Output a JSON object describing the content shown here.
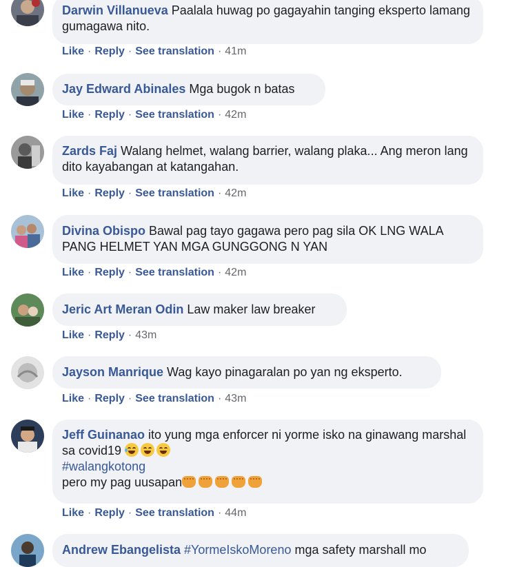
{
  "comments": [
    {
      "author": "Darwin Villanueva",
      "text": "Paalala huwag po gagayahin tanging eksperto lamang gumagawa nito.",
      "actions": {
        "like": "Like",
        "reply": "Reply",
        "translate": "See translation",
        "time": "41m"
      }
    },
    {
      "author": "Jay Edward Abinales",
      "text": "Mga bugok n batas",
      "actions": {
        "like": "Like",
        "reply": "Reply",
        "translate": "See translation",
        "time": "42m"
      }
    },
    {
      "author": "Zards Faj",
      "text": "Walang helmet, walang barrier, walang plaka... Ang meron lang dito kayabangan at katangahan.",
      "actions": {
        "like": "Like",
        "reply": "Reply",
        "translate": "See translation",
        "time": "42m"
      }
    },
    {
      "author": "Divina Obispo",
      "text": "Bawal pag tayo gagawa pero pag sila OK LNG WALA PANG HELMET YAN MGA GUNGGONG N YAN",
      "actions": {
        "like": "Like",
        "reply": "Reply",
        "translate": "See translation",
        "time": "42m"
      }
    },
    {
      "author": "Jeric Art Meran Odin",
      "text": "Law maker law breaker",
      "actions": {
        "like": "Like",
        "reply": "Reply",
        "time": "43m"
      }
    },
    {
      "author": "Jayson Manrique",
      "text": "Wag kayo pinagaralan po yan ng eksperto.",
      "actions": {
        "like": "Like",
        "reply": "Reply",
        "translate": "See translation",
        "time": "43m"
      }
    },
    {
      "author": "Jeff Guinanao",
      "text": "ito yung mga enforcer ni yorme isko na ginawang marshal sa covid19",
      "hashtag": "#walangkotong",
      "text2": "pero my pag uusapan",
      "emoji": "laughing-crying-face x3, fist x5",
      "actions": {
        "like": "Like",
        "reply": "Reply",
        "translate": "See translation",
        "time": "44m"
      }
    },
    {
      "author": "Andrew Ebangelista",
      "hashtag": "#YormeIskoMoreno",
      "text": "mga safety marshall mo"
    }
  ],
  "colors": {
    "link": "#385898",
    "bubble": "#f0f2f5",
    "meta": "#65676b"
  }
}
